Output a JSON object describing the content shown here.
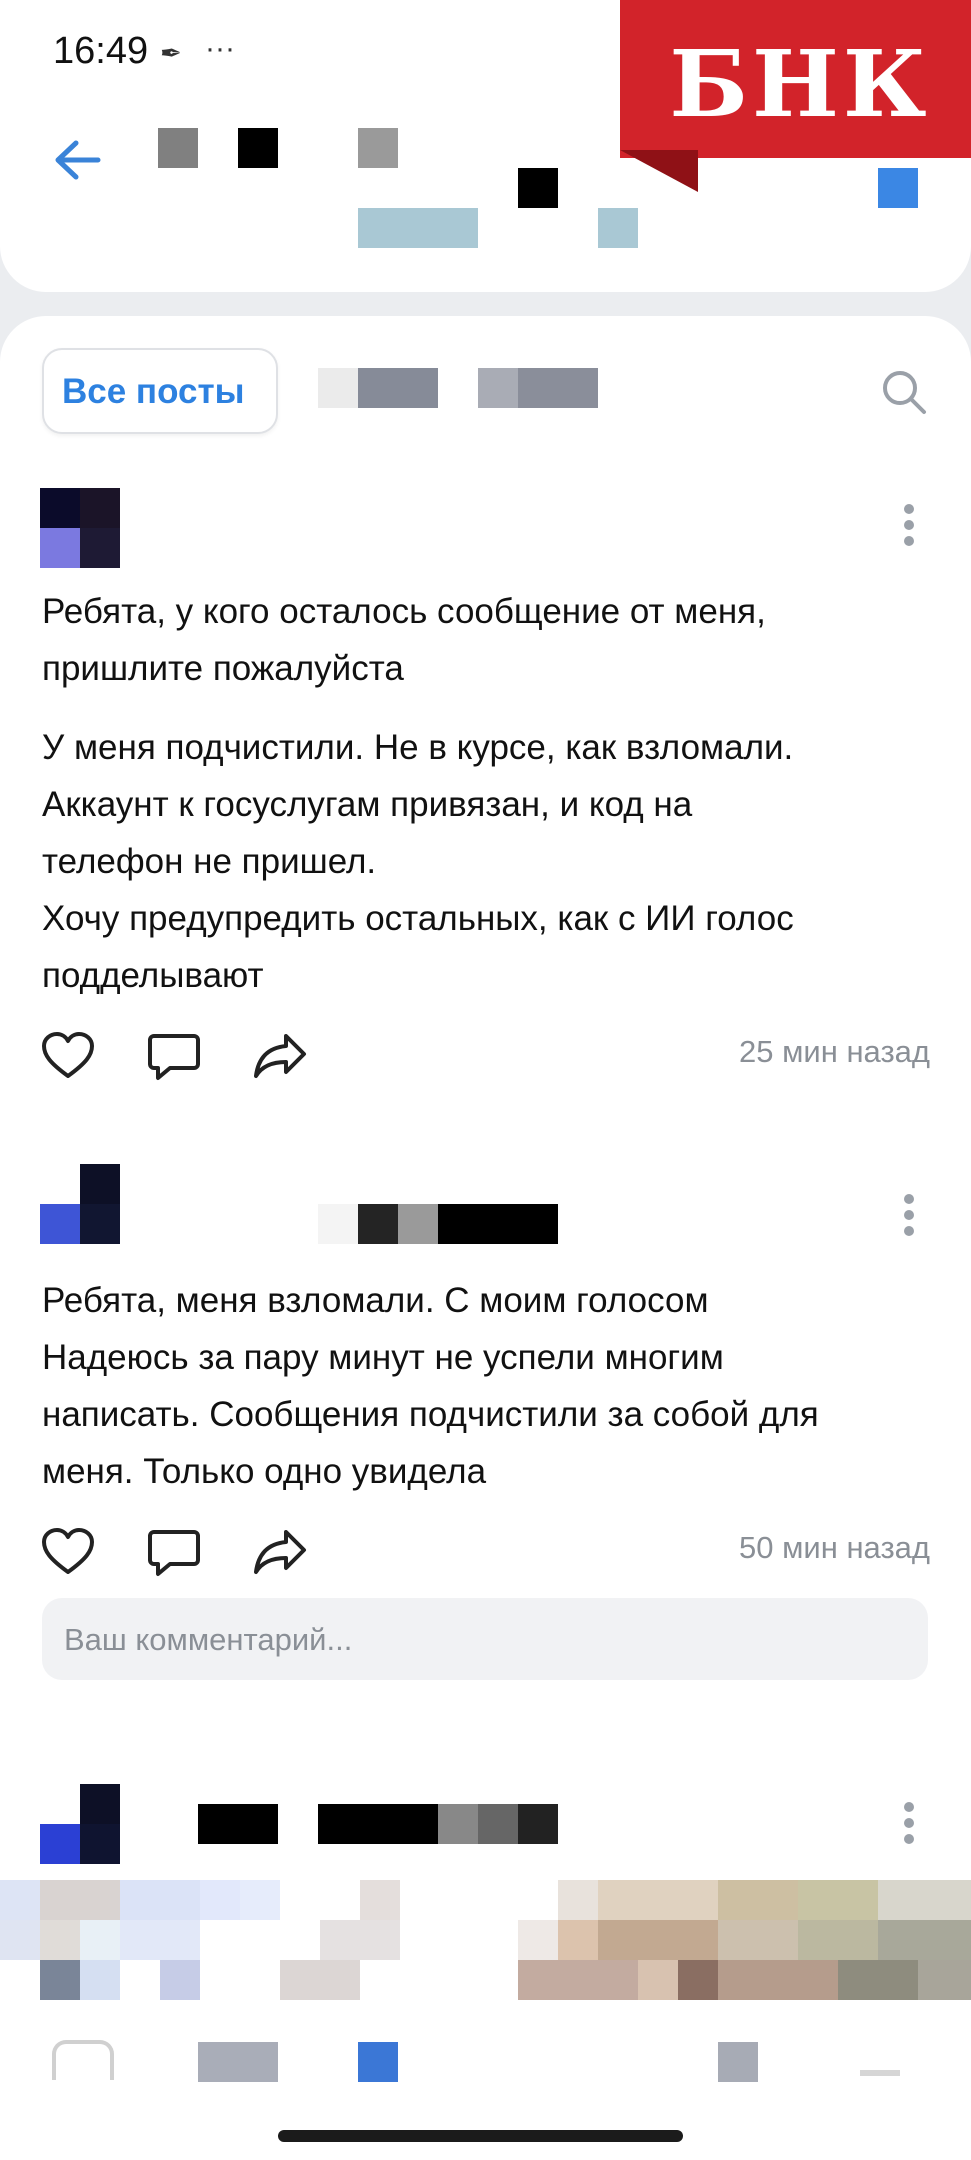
{
  "status_bar": {
    "time": "16:49",
    "more": "···"
  },
  "brand": {
    "logo_text": "БНК"
  },
  "tabs": {
    "all_posts_label": "Все посты"
  },
  "posts": [
    {
      "title": "Ребята, у кого осталось сообщение от меня, пришлите пожалуйста",
      "body_lines": [
        "У меня подчистили. Не в курсе, как взломали.",
        "Аккаунт к госуслугам привязан, и код на",
        "телефон не пришел.",
        "Хочу предупредить остальных, как с ИИ голос",
        "подделывают"
      ],
      "time": "25 мин назад"
    },
    {
      "body_lines": [
        "Ребята, меня взломали. С моим голосом",
        "Надеюсь за пару минут не успели многим",
        "написать. Сообщения подчистили за собой для",
        "меня. Только одно увидела"
      ],
      "time": "50 мин назад"
    }
  ],
  "comment": {
    "placeholder": "Ваш комментарий..."
  },
  "icons": {
    "back": "arrow-left-icon",
    "search": "search-icon",
    "more": "more-vertical-icon",
    "like": "heart-icon",
    "comment": "comment-icon",
    "share": "share-icon"
  },
  "colors": {
    "accent": "#2d81e0",
    "brand_red": "#d2232a"
  }
}
